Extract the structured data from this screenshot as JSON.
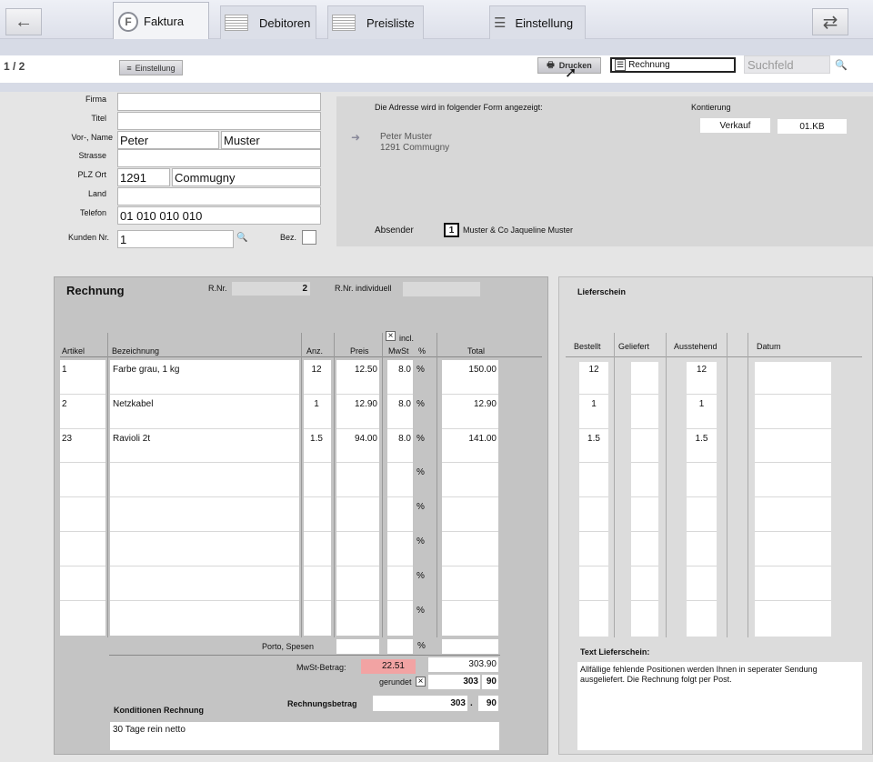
{
  "toolbar": {
    "tabs": [
      {
        "label": "Faktura",
        "icon": "f-circle-icon"
      },
      {
        "label": "Debitoren",
        "icon": "table-icon"
      },
      {
        "label": "Preisliste",
        "icon": "table-icon"
      },
      {
        "label": "Einstellung",
        "icon": "list-icon"
      }
    ],
    "back_icon": "←",
    "swap_icon": "⇄"
  },
  "subbar": {
    "page": "1 / 2",
    "einstellung": "Einstellung",
    "drucken": "Drucken",
    "document_type": "Rechnung",
    "search_placeholder": "Suchfeld"
  },
  "address": {
    "labels": {
      "firma": "Firma",
      "titel": "Titel",
      "name": "Vor-, Name",
      "strasse": "Strasse",
      "plz": "PLZ Ort",
      "land": "Land",
      "telefon": "Telefon",
      "kunden": "Kunden Nr.",
      "bez": "Bez."
    },
    "firma": "",
    "titel": "",
    "vorname": "Peter",
    "nachname": "Muster",
    "strasse": "",
    "plz": "1291",
    "ort": "Commugny",
    "land": "",
    "telefon": "01 010 010 010",
    "kunden_nr": "1"
  },
  "preview": {
    "caption": "Die Adresse wird in folgender Form angezeigt:",
    "line1": "Peter Muster",
    "line2": "1291 Commugny",
    "kontierung_label": "Kontierung",
    "verkauf": "Verkauf",
    "konto": "01.KB",
    "absender_label": "Absender",
    "absender_nr": "1",
    "absender_text": "Muster & Co Jaqueline  Muster"
  },
  "invoice": {
    "title": "Rechnung",
    "rnr_label": "R.Nr.",
    "rnr": "2",
    "rnr_ind_label": "R.Nr. individuell",
    "incl_label": "incl.",
    "headers": {
      "artikel": "Artikel",
      "bez": "Bezeichnung",
      "anz": "Anz.",
      "preis": "Preis",
      "mwst": "MwSt",
      "pct": "%",
      "total": "Total"
    },
    "rows": [
      {
        "artikel": "1",
        "bez": "Farbe grau, 1 kg",
        "anz": "12",
        "preis": "12.50",
        "mwst": "8.0",
        "pct": "%",
        "total": "150.00"
      },
      {
        "artikel": "2",
        "bez": "Netzkabel",
        "anz": "1",
        "preis": "12.90",
        "mwst": "8.0",
        "pct": "%",
        "total": "12.90"
      },
      {
        "artikel": "23",
        "bez": "Ravioli 2t",
        "anz": "1.5",
        "preis": "94.00",
        "mwst": "8.0",
        "pct": "%",
        "total": "141.00"
      },
      {
        "artikel": "",
        "bez": "",
        "anz": "",
        "preis": "",
        "mwst": "",
        "pct": "%",
        "total": ""
      },
      {
        "artikel": "",
        "bez": "",
        "anz": "",
        "preis": "",
        "mwst": "",
        "pct": "%",
        "total": ""
      },
      {
        "artikel": "",
        "bez": "",
        "anz": "",
        "preis": "",
        "mwst": "",
        "pct": "%",
        "total": ""
      },
      {
        "artikel": "",
        "bez": "",
        "anz": "",
        "preis": "",
        "mwst": "",
        "pct": "%",
        "total": ""
      },
      {
        "artikel": "",
        "bez": "",
        "anz": "",
        "preis": "",
        "mwst": "",
        "pct": "%",
        "total": ""
      }
    ],
    "porto_label": "Porto, Spesen",
    "porto_pct": "%",
    "mwst_label": "MwSt-Betrag:",
    "mwst_value": "22.51",
    "subtotal": "303.90",
    "gerundet_label": "gerundet",
    "gerundet_int": "303",
    "gerundet_dec": "90",
    "betrag_label": "Rechnungsbetrag",
    "betrag_int": "303",
    "betrag_sep": ".",
    "betrag_dec": "90",
    "konditionen_label": "Konditionen Rechnung",
    "konditionen": "30 Tage rein netto"
  },
  "lieferschein": {
    "title": "Lieferschein",
    "headers": {
      "bestellt": "Bestellt",
      "geliefert": "Geliefert",
      "ausstehend": "Ausstehend",
      "datum": "Datum"
    },
    "rows": [
      {
        "bestellt": "12",
        "geliefert": "",
        "ausstehend": "12",
        "datum": ""
      },
      {
        "bestellt": "1",
        "geliefert": "",
        "ausstehend": "1",
        "datum": ""
      },
      {
        "bestellt": "1.5",
        "geliefert": "",
        "ausstehend": "1.5",
        "datum": ""
      }
    ],
    "text_label": "Text Lieferschein:",
    "text": "Allfällige fehlende Positionen werden Ihnen in seperater Sendung ausgeliefert. Die Rechnung folgt per Post."
  }
}
